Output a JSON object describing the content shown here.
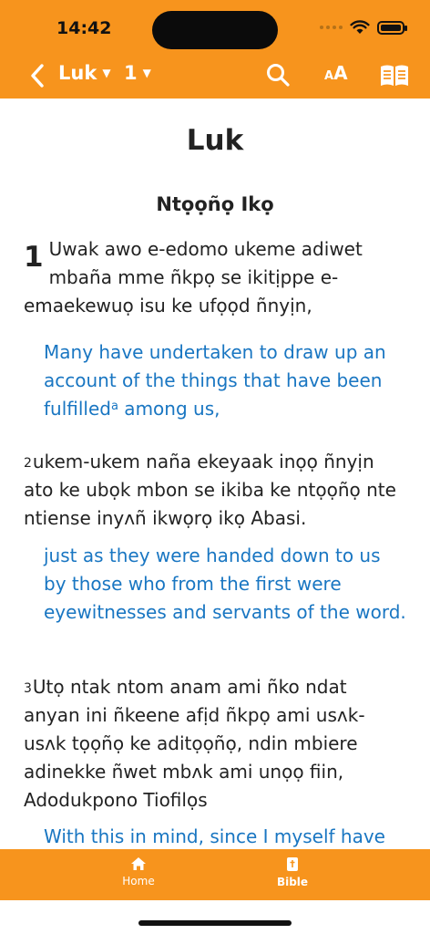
{
  "status": {
    "time": "14:42"
  },
  "header": {
    "book": "Luk",
    "chapter": "1",
    "text_size_label_small": "A",
    "text_size_label_big": "A"
  },
  "content": {
    "book_title": "Luk",
    "section_heading": "Ntọọñọ Ikọ",
    "chapter_number": "1",
    "verse1_text": "Uwak awo e-edomo ukeme adiwet mbaña mme ñkpọ se ikitịppe e-emaekewuọ isu ke ufọọd ñnyịn,",
    "verse1_eng_a": "Many have undertaken to draw up an account of the things that have been fulfilled",
    "footnote_a": "a",
    "verse1_eng_b": " among us,",
    "verse2_num": "2",
    "verse2_text": "ukem-ukem naña ekeyaak inọọ ñnyịn ato ke ubọk mbon se ikiba ke ntọọñọ nte ntiense inyʌñ ikwọrọ ikọ Abasi.",
    "verse2_eng": "just as they were handed down to us by those who from the first were eyewitnesses and servants of the word.",
    "verse3_num": "3",
    "verse3_text": "Utọ ntak ntom anam ami ñko ndat anyan ini ñkeene afịd ñkpọ ami usʌk-usʌk tọọñọ ke aditọọñọ, ndin mbiere adinekke ñwet mbʌk ami unọọ fiin, Adodukpono Tiofilọs",
    "verse3_eng": "With this in mind, since I myself have"
  },
  "tabbar": {
    "home_label": "Home",
    "bible_label": "Bible"
  },
  "colors": {
    "accent": "#F7941D",
    "link_blue": "#1976C2"
  }
}
